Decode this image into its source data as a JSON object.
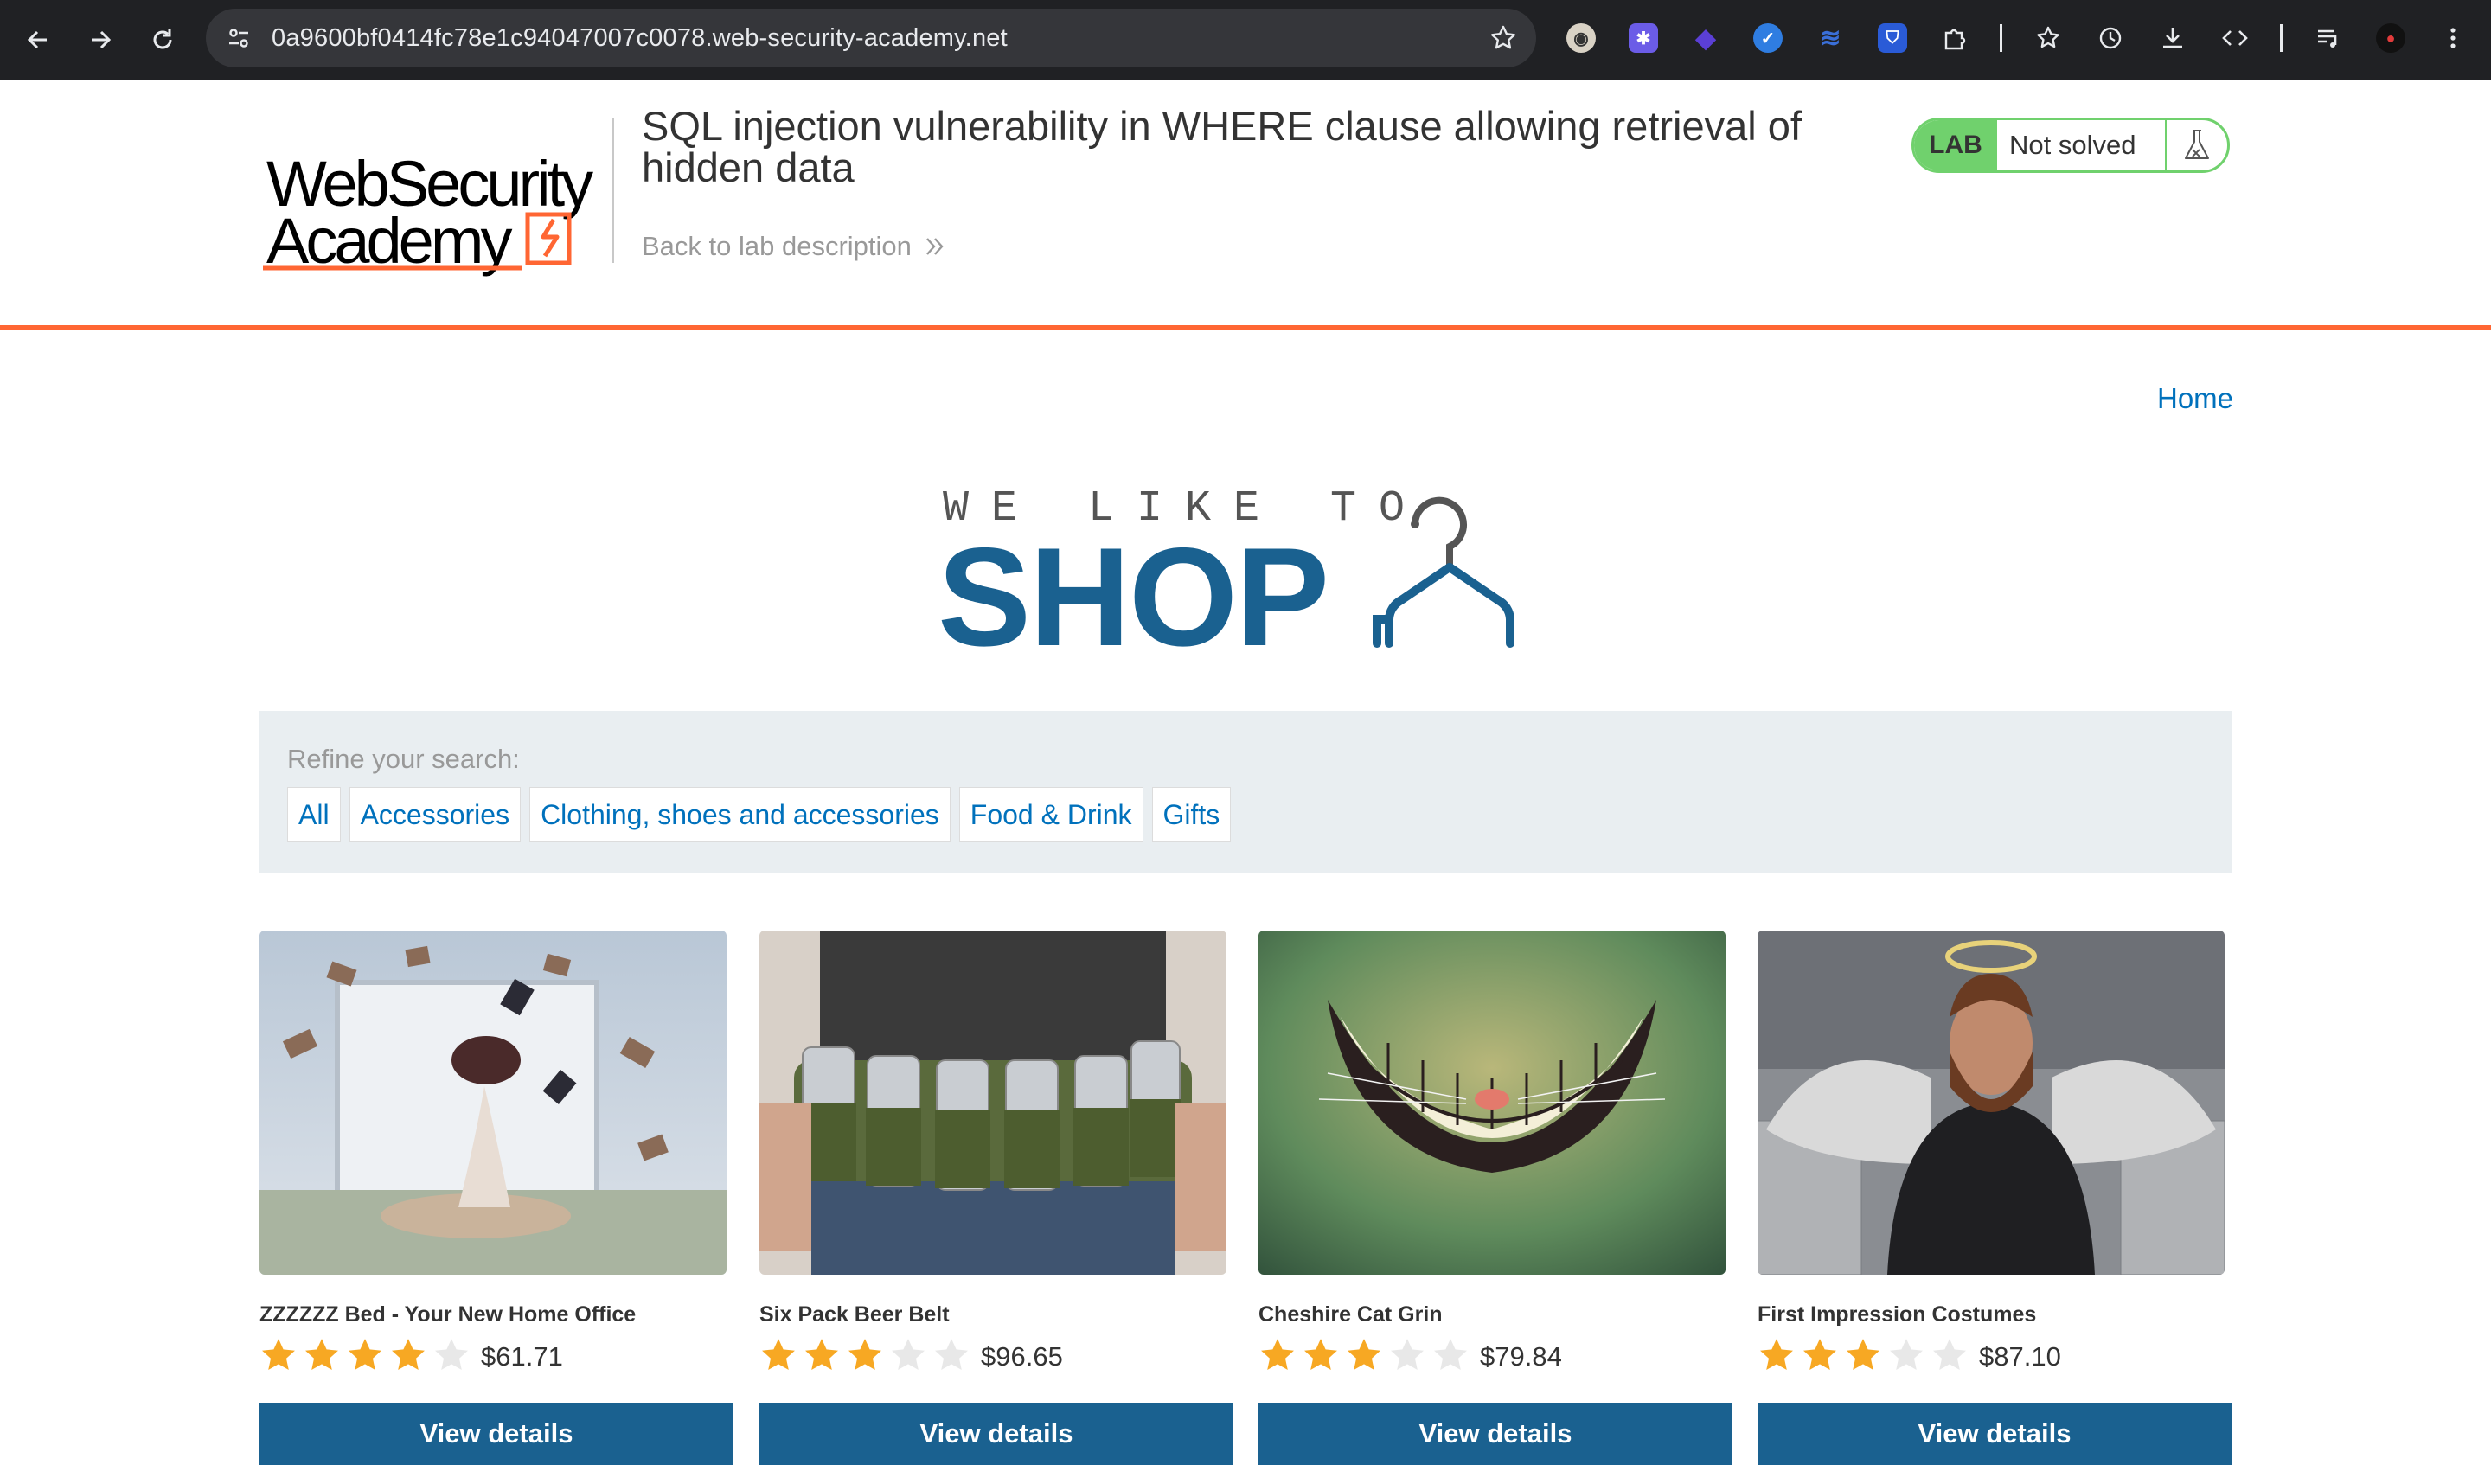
{
  "browser": {
    "url": "0a9600bf0414fc78e1c94047007c0078.web-security-academy.net"
  },
  "academy": {
    "logo_line1": "WebSecurity",
    "logo_line2": "Academy",
    "lab_title": "SQL injection vulnerability in WHERE clause allowing retrieval of hidden data",
    "back_link": "Back to lab description",
    "lab_badge": "LAB",
    "lab_status": "Not solved",
    "accent_color": "#ff6633",
    "badge_color": "#70d16d"
  },
  "shop": {
    "home_link": "Home",
    "logo_small": "WE LIKE TO",
    "logo_big": "SHOP",
    "brand_color": "#1a6190",
    "refine_label": "Refine your search:",
    "filters": [
      "All",
      "Accessories",
      "Clothing, shoes and accessories",
      "Food & Drink",
      "Gifts"
    ],
    "products": [
      {
        "name": "ZZZZZZ Bed - Your New Home Office",
        "rating": 4,
        "price": "$61.71",
        "button": "View details"
      },
      {
        "name": "Six Pack Beer Belt",
        "rating": 3,
        "price": "$96.65",
        "button": "View details"
      },
      {
        "name": "Cheshire Cat Grin",
        "rating": 3,
        "price": "$79.84",
        "button": "View details"
      },
      {
        "name": "First Impression Costumes",
        "rating": 3,
        "price": "$87.10",
        "button": "View details"
      }
    ]
  }
}
